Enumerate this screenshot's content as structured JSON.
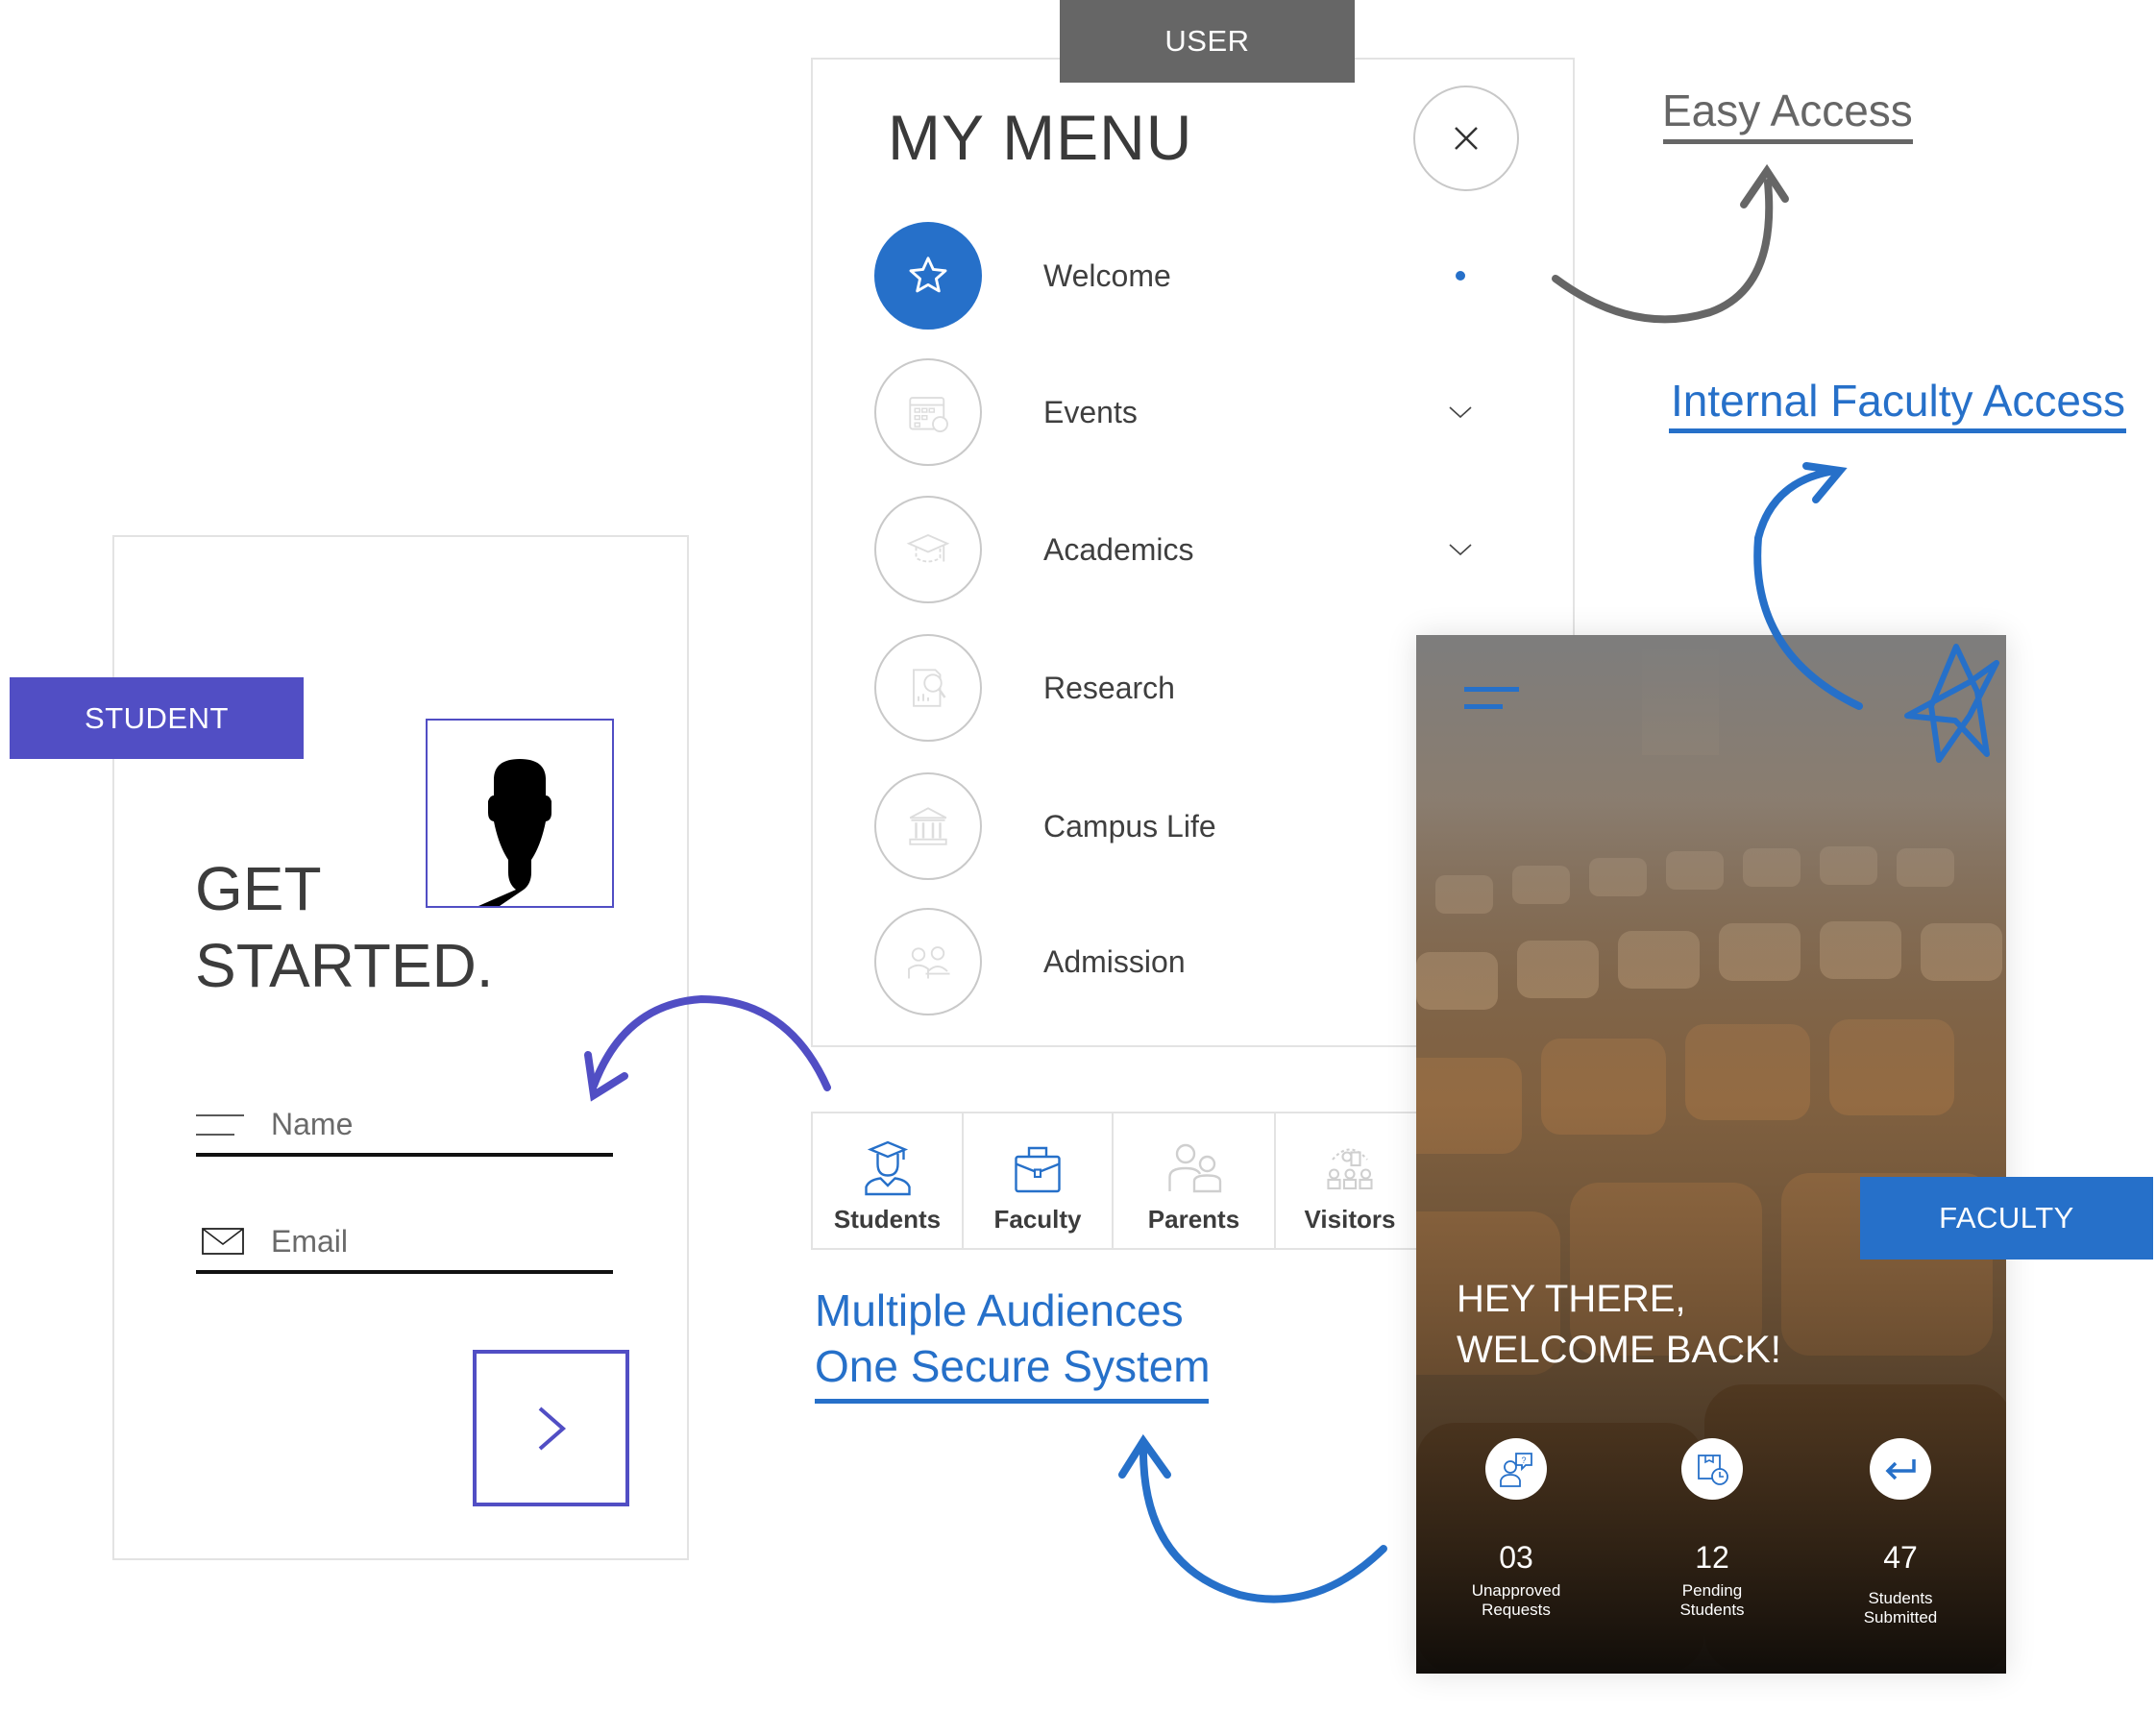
{
  "tags": {
    "user": "USER",
    "student": "STUDENT",
    "faculty": "FACULTY"
  },
  "menu": {
    "title": "MY MENU",
    "close_icon": "close-icon",
    "items": [
      {
        "label": "Welcome",
        "icon": "star-icon",
        "active": true,
        "trailing": "dot"
      },
      {
        "label": "Events",
        "icon": "calendar-icon",
        "active": false,
        "trailing": "chevron-down"
      },
      {
        "label": "Academics",
        "icon": "graduation-cap-icon",
        "active": false,
        "trailing": "chevron-down"
      },
      {
        "label": "Research",
        "icon": "research-report-icon",
        "active": false,
        "trailing": ""
      },
      {
        "label": "Campus Life",
        "icon": "campus-building-icon",
        "active": false,
        "trailing": ""
      },
      {
        "label": "Admission",
        "icon": "admission-icon",
        "active": false,
        "trailing": ""
      }
    ]
  },
  "audiences": [
    {
      "label": "Students",
      "icon": "graduate-student-icon",
      "color": "#2670C9"
    },
    {
      "label": "Faculty",
      "icon": "briefcase-icon",
      "color": "#2670C9"
    },
    {
      "label": "Parents",
      "icon": "parents-icon",
      "color": "#cfcfcf"
    },
    {
      "label": "Visitors",
      "icon": "visitors-icon",
      "color": "#cfcfcf"
    }
  ],
  "callouts": {
    "multiple_line1": "Multiple Audiences",
    "multiple_line2": "One Secure System",
    "easy_access": "Easy Access",
    "internal_faculty_access": "Internal Faculty Access"
  },
  "student": {
    "heading_line1": "GET",
    "heading_line2": "STARTED.",
    "name_placeholder": "Name",
    "email_placeholder": "Email",
    "next_icon": "chevron-right-icon"
  },
  "faculty_app": {
    "greeting_line1": "HEY THERE,",
    "greeting_line2": "WELCOME BACK!",
    "stats": [
      {
        "value": "03",
        "label_line1": "Unapproved",
        "label_line2": "Requests",
        "icon": "request-question-icon"
      },
      {
        "value": "12",
        "label_line1": "Pending",
        "label_line2": "Students",
        "icon": "pending-clock-icon"
      },
      {
        "value": "47",
        "label_line1": "Students",
        "label_line2": "Submitted",
        "icon": "return-arrow-icon"
      }
    ]
  },
  "colors": {
    "primary_blue": "#2670C9",
    "student_purple": "#514EC4",
    "user_gray": "#666666",
    "text_dark": "#3c3c3c",
    "border_light": "#e3e3e3"
  }
}
